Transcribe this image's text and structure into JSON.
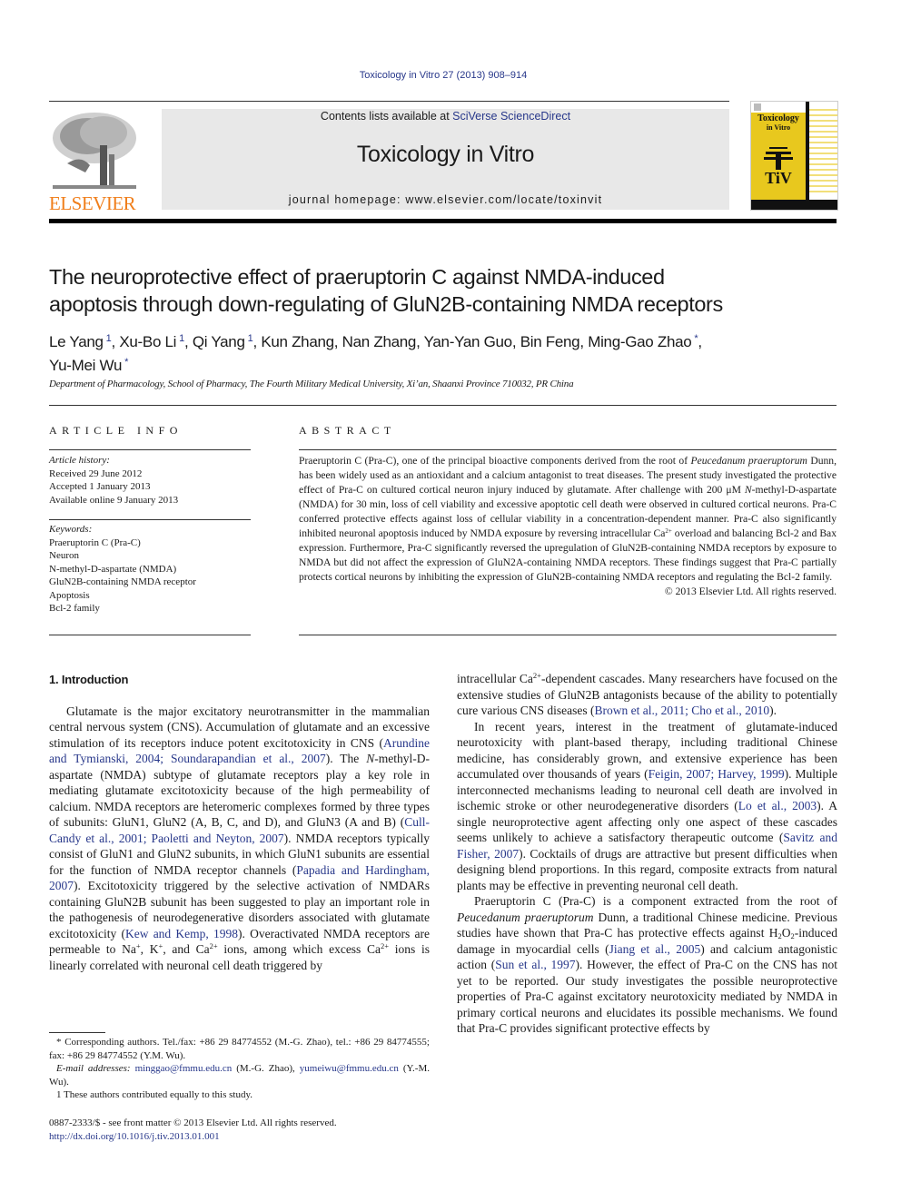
{
  "journal_citation": "Toxicology in Vitro 27 (2013) 908–914",
  "header": {
    "publisher_logo_text": "ELSEVIER",
    "contents_prefix": "Contents lists available at ",
    "contents_link": "SciVerse ScienceDirect",
    "journal_title": "Toxicology in Vitro",
    "homepage": "journal homepage: www.elsevier.com/locate/toxinvit",
    "cover": {
      "title_line1": "Toxicology",
      "title_line2": "in Vitro",
      "monogram": "TiV",
      "colors": {
        "yellow": "#e8c81e",
        "black": "#111111"
      }
    }
  },
  "article": {
    "title_line1": "The neuroprotective effect of praeruptorin C against NMDA-induced",
    "title_line2": "apoptosis through down-regulating of GluN2B-containing NMDA receptors",
    "authors": [
      {
        "name": "Le Yang",
        "mark": "1"
      },
      {
        "name": "Xu-Bo Li",
        "mark": "1"
      },
      {
        "name": "Qi Yang",
        "mark": "1"
      },
      {
        "name": "Kun Zhang",
        "mark": ""
      },
      {
        "name": "Nan Zhang",
        "mark": ""
      },
      {
        "name": "Yan-Yan Guo",
        "mark": ""
      },
      {
        "name": "Bin Feng",
        "mark": ""
      },
      {
        "name": "Ming-Gao Zhao",
        "mark": "*"
      },
      {
        "name": "Yu-Mei Wu",
        "mark": "*"
      }
    ],
    "affiliation": "Department of Pharmacology, School of Pharmacy, The Fourth Military Medical University, Xi’an, Shaanxi Province 710032, PR China"
  },
  "article_info": {
    "heading": "ARTICLE INFO",
    "history_label": "Article history:",
    "history": [
      "Received 29 June 2012",
      "Accepted 1 January 2013",
      "Available online 9 January 2013"
    ],
    "keywords_label": "Keywords:",
    "keywords": [
      "Praeruptorin C (Pra-C)",
      "Neuron",
      "N-methyl-D-aspartate (NMDA)",
      "GluN2B-containing NMDA receptor",
      "Apoptosis",
      "Bcl-2 family"
    ]
  },
  "abstract": {
    "heading": "ABSTRACT",
    "p1": "Praeruptorin C (Pra-C), one of the principal bioactive components derived from the root of ",
    "p1_italic": "Peucedanum praeruptorum",
    "p2": " Dunn, has been widely used as an antioxidant and a calcium antagonist to treat diseases. The present study investigated the protective effect of Pra-C on cultured cortical neuron injury induced by glutamate. After challenge with 200 μM ",
    "p2_italic": "N",
    "p3": "-methyl-D-aspartate (NMDA) for 30 min, loss of cell viability and excessive apoptotic cell death were observed in cultured cortical neurons. Pra-C conferred protective effects against loss of cellular viability in a concentration-dependent manner. Pra-C also significantly inhibited neuronal apoptosis induced by NMDA exposure by reversing intracellular Ca",
    "p3_sup": "2+",
    "p4": " overload and balancing Bcl-2 and Bax expression. Furthermore, Pra-C significantly reversed the upregulation of GluN2B-containing NMDA receptors by exposure to NMDA but did not affect the expression of GluN2A-containing NMDA receptors. These findings suggest that Pra-C partially protects cortical neurons by inhibiting the expression of GluN2B-containing NMDA receptors and regulating the Bcl-2 family.",
    "copyright": "© 2013 Elsevier Ltd. All rights reserved."
  },
  "body": {
    "section_heading": "1. Introduction",
    "left": {
      "t1": "Glutamate is the major excitatory neurotransmitter in the mammalian central nervous system (CNS). Accumulation of gluta­mate and an excessive stimulation of its receptors induce potent excitotoxicity in CNS (",
      "r1": "Arundine and Tymianski, 2004; Soundara­pandian et al., 2007",
      "t2": "). The ",
      "t2_italic": "N",
      "t3": "-methyl-D-aspartate (NMDA) subtype of glutamate receptors play a key role in mediating glutamate excitotoxicity because of the high permeability of calcium. NMDA receptors are heteromeric complexes formed by three types of sub­units: GluN1, GluN2 (A, B, C, and D), and GluN3 (A and B) (",
      "r2": "Cull-Candy et al., 2001; Paoletti and Neyton, 2007",
      "t4": "). NMDA receptors typically consist of GluN1 and GluN2 subunits, in which GluN1 subunits are essential for the function of NMDA receptor channels (",
      "r3": "Papadia and Hardingham, 2007",
      "t5": "). Excitotoxicity triggered by the selective activation of NMDARs containing GluN2B subunit has been suggested to play an important role in the pathogenesis of neurodegenerative disorders associated with glutamate excitotox­icity (",
      "r4": "Kew and Kemp, 1998",
      "t6": "). Overactivated NMDA receptors are permeable to Na",
      "s1": "+",
      "t7": ", K",
      "s2": "+",
      "t8": ", and Ca",
      "s3": "2+",
      "t9": " ions, among which excess Ca",
      "s4": "2+",
      "t10": " ions is linearly correlated with neuronal cell death triggered by"
    },
    "right": {
      "a1": "intracellular Ca",
      "a1_sup": "2+",
      "a2": "-dependent cascades. Many researchers have fo­cused on the extensive studies of GluN2B antagonists because of the ability to potentially cure various CNS diseases (",
      "a_r1": "Brown et al., 2011; Cho et al., 2010",
      "a3": ").",
      "b1": "In recent years, interest in the treatment of glutamate-induced neurotoxicity with plant-based therapy, including traditional Chi­nese medicine, has considerably grown, and extensive experience has been accumulated over thousands of years (",
      "b_r1": "Feigin, 2007; Harvey, 1999",
      "b2": "). Multiple interconnected mechanisms leading to neuronal cell death are involved in ischemic stroke or other neuro­degenerative disorders (",
      "b_r2": "Lo et al., 2003",
      "b3": "). A single neuroprotective agent affecting only one aspect of these cascades seems unlikely to achieve a satisfactory therapeutic outcome (",
      "b_r3": "Savitz and Fisher, 2007",
      "b4": "). Cocktails of drugs are attractive but present difficulties when designing blend proportions. In this regard, composite ex­tracts from natural plants may be effective in preventing neuronal cell death.",
      "c1": "Praeruptorin C (Pra-C) is a component extracted from the root of ",
      "c1_italic": "Peucedanum praeruptorum",
      "c2": " Dunn, a traditional Chinese medicine. Previous studies have shown that Pra-C has protective effects against H",
      "c2_sub1": "2",
      "c2b": "O",
      "c2_sub2": "2",
      "c3": "-induced damage in myocardial cells (",
      "c_r1": "Jiang et al., 2005",
      "c4": ") and calcium antagonistic action (",
      "c_r2": "Sun et al., 1997",
      "c5": "). However, the effect of Pra-C on the CNS has not yet to be reported. Our study investigates the possible neuroprotective properties of Pra-C against excitatory neurotoxicity mediated by NMDA in primary cortical neurons and elucidates its possible mechanisms. We found that Pra-C provides significant protective effects by"
    }
  },
  "footnotes": {
    "corresponding": "* Corresponding authors. Tel./fax: +86 29 84774552 (M.-G. Zhao), tel.: +86 29 84774555; fax: +86 29 84774552 (Y.M. Wu).",
    "email_label": "E-mail addresses: ",
    "email1": "minggao@fmmu.edu.cn",
    "email1_who": " (M.-G. Zhao), ",
    "email2": "yumeiwu@fmmu.edu.cn",
    "email2_who": " (Y.-M. Wu).",
    "equal": "1  These authors contributed equally to this study."
  },
  "front_matter": {
    "issn_line": "0887-2333/$ - see front matter © 2013 Elsevier Ltd. All rights reserved.",
    "doi": "http://dx.doi.org/10.1016/j.tiv.2013.01.001"
  }
}
